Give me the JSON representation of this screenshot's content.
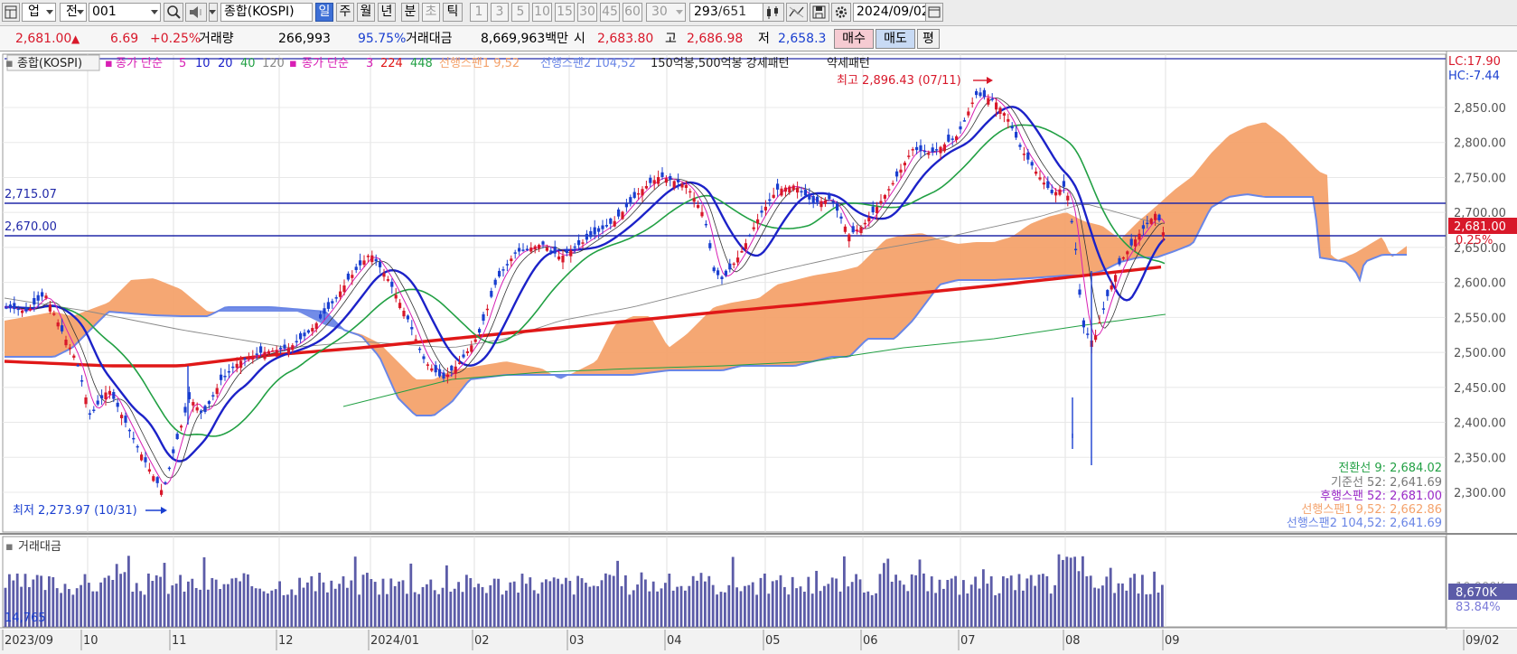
{
  "toolbar": {
    "market_label": "업",
    "prev_label": "전",
    "code_value": "001",
    "index_name": "종합(KOSPI)",
    "period_tabs": [
      "일",
      "주",
      "월",
      "년",
      "분",
      "초",
      "틱"
    ],
    "minute_values": [
      "1",
      "3",
      "5",
      "10",
      "15",
      "30",
      "45",
      "60"
    ],
    "interval_value": "30",
    "count_value": "293",
    "count_total": "/651",
    "date_value": "2024/09/02"
  },
  "quote": {
    "price": "2,681.00",
    "arrow": "▲",
    "change": "6.69",
    "change_pct": "+0.25%",
    "volume_label": "거래량",
    "volume": "266,993",
    "volume_pct": "95.75%",
    "amount_label": "거래대금",
    "amount": "8,669,963백만",
    "open_label": "시",
    "open": "2,683.80",
    "high_label": "고",
    "high": "2,686.98",
    "low_label": "저",
    "low": "2,658.3",
    "buy_label": "매수",
    "sell_label": "매도",
    "avg_label": "평"
  },
  "legend": {
    "title": "종합(KOSPI)",
    "ma1_label": "종가 단순",
    "ma1_periods": [
      "5",
      "10",
      "20",
      "40",
      "120"
    ],
    "ma2_label": "종가 단순",
    "ma2_periods": [
      "3",
      "224",
      "448"
    ],
    "span1": "선행스팬1 9,52",
    "span2": "선행스팬2 104,52",
    "pattern": "150억봉,500억봉 강세패턴",
    "pattern2": "약세패턴"
  },
  "top_right": {
    "lc": "LC:17.90",
    "hc": "HC:-7.44"
  },
  "annotations": {
    "high": "최고 2,896.43 (07/11)",
    "low": "최저 2,273.97 (10/31)",
    "line1": "2,715.07",
    "line2": "2,670.00"
  },
  "price_axis": [
    "2,850.00",
    "2,800.00",
    "2,750.00",
    "2,700.00",
    "2,650.00",
    "2,600.00",
    "2,550.00",
    "2,500.00",
    "2,450.00",
    "2,400.00",
    "2,350.00",
    "2,300.00"
  ],
  "price_badge": {
    "value": "2,681.00",
    "pct": "0.25%"
  },
  "ichimoku": {
    "conversion": "전환선 9: 2,684.02",
    "base": "기준선 52: 2,641.69",
    "lagging": "후행스팬 52: 2,681.00",
    "leading1": "선행스팬1 9,52: 2,662.86",
    "leading2": "선행스팬2 104,52: 2,641.69"
  },
  "volume_panel": {
    "title": "거래대금",
    "min_label": "14,765",
    "axis_label": "10,000K",
    "badge_value": "8,670K",
    "badge_pct": "83.84%"
  },
  "x_axis": [
    "2023/09",
    "10",
    "11",
    "12",
    "2024/01",
    "02",
    "03",
    "04",
    "05",
    "06",
    "07",
    "08",
    "09",
    "09/02"
  ],
  "colors": {
    "up": "#d8182a",
    "down": "#1a3fd0",
    "ma5": "#d81fb4",
    "ma20": "#1c22c8",
    "ma40": "#22a044",
    "ma224": "#e01818",
    "cloud_up": "#f4a26b",
    "cloud_down": "#6a86e6",
    "hline": "#2028a8",
    "volume": "#5c5ca8",
    "axis_text": "#555555"
  }
}
